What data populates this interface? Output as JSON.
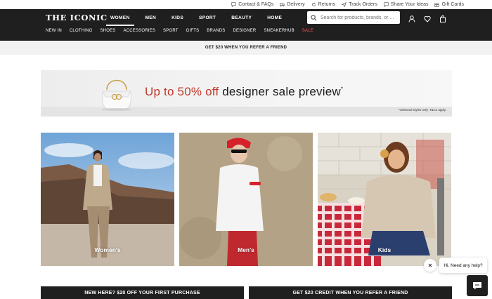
{
  "utility": {
    "contact": "Contact & FAQs",
    "delivery": "Delivery",
    "returns": "Returns",
    "track": "Track Orders",
    "share": "Share Your Ideas",
    "gift": "Gift Cards"
  },
  "header": {
    "logo": "THE ICONIC",
    "tabs": [
      "WOMEN",
      "MEN",
      "KIDS",
      "SPORT",
      "BEAUTY",
      "HOME"
    ],
    "active_tab": "WOMEN",
    "search_placeholder": "Search for products, brands, or ...",
    "subnav": [
      "NEW IN",
      "CLOTHING",
      "SHOES",
      "ACCESSORIES",
      "SPORT",
      "GIFTS",
      "BRANDS",
      "DESIGNER",
      "SNEAKERHUB",
      "SALE"
    ]
  },
  "promo_strip": "GET $20 WHEN YOU REFER A FRIEND",
  "banner": {
    "highlight": "Up to 50% off",
    "rest": " designer sale preview",
    "asterisk": "*",
    "fine_print": "*Selected styles only. T&Cs apply."
  },
  "tiles": [
    {
      "label": "Women's"
    },
    {
      "label": "Men's"
    },
    {
      "label": "Kids"
    }
  ],
  "bottom_promos": {
    "left": "NEW HERE? $20 OFF YOUR FIRST PURCHASE",
    "right": "GET $20 CREDIT WHEN YOU REFER A FRIEND"
  },
  "chat": {
    "bubble": "Hi. Need any help?"
  },
  "colors": {
    "header_bg": "#1f1f1f",
    "sale_red": "#ff5a5a",
    "banner_red": "#c0392b"
  }
}
